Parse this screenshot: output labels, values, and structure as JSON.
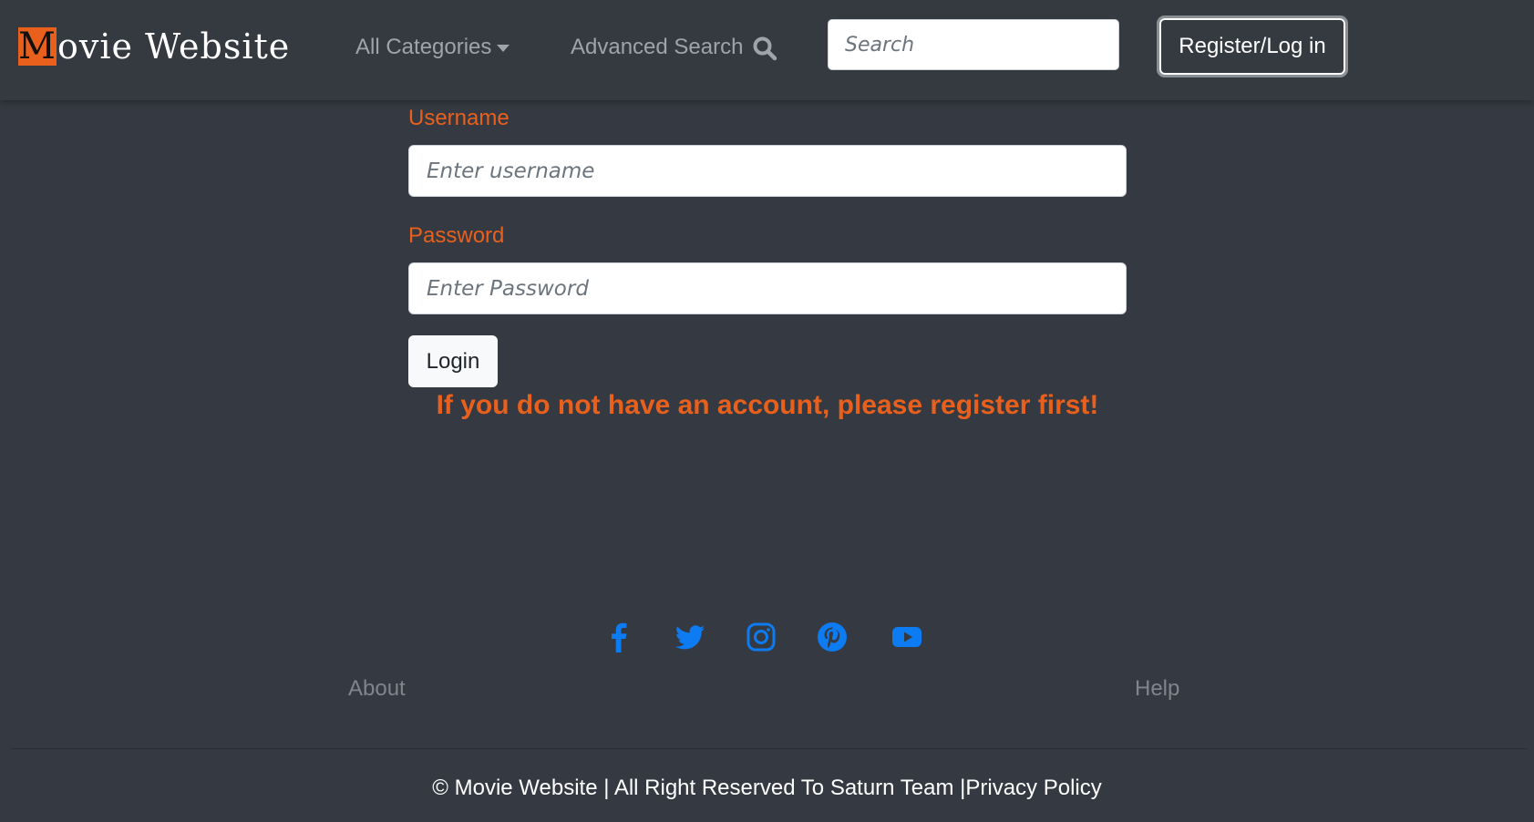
{
  "navbar": {
    "brand_initial": "M",
    "brand_rest": "ovie Website",
    "categories_label": "All Categories",
    "advanced_search_label": "Advanced Search",
    "search_placeholder": "Search",
    "register_login_label": "Register/Log in",
    "icons": {
      "categories": "caret-down-icon",
      "advanced_search": "search-icon"
    }
  },
  "login_form": {
    "username_label": "Username",
    "username_placeholder": "Enter username",
    "password_label": "Password",
    "password_placeholder": "Enter Password",
    "login_button": "Login",
    "register_notice": "If you do not have an account, please register first!"
  },
  "footer": {
    "social_icons": [
      "facebook-icon",
      "twitter-icon",
      "instagram-icon",
      "pinterest-icon",
      "youtube-icon"
    ],
    "about_label": "About",
    "help_label": "Help",
    "copyright_text": "© Movie Website | All Right Reserved To Saturn Team |",
    "privacy_label": "Privacy Policy"
  },
  "colors": {
    "page_background": "#353a42",
    "navbar_background": "#343a40",
    "accent_orange": "#e8601c",
    "social_icon_blue": "#0d7bf2",
    "muted_text": "#9fa4aa"
  }
}
